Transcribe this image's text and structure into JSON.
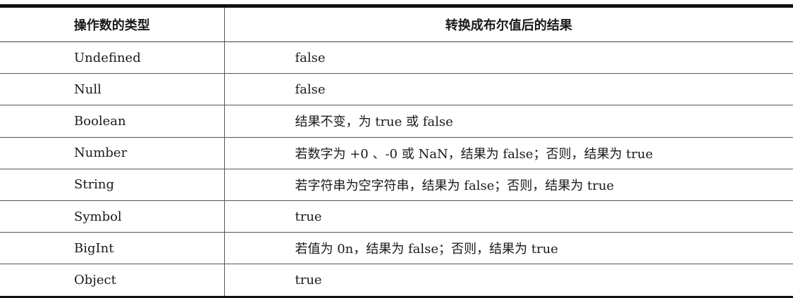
{
  "table": {
    "headers": [
      "操作数的类型",
      "转换成布尔值后的结果"
    ],
    "rows": [
      {
        "type": "Undefined",
        "result": "false"
      },
      {
        "type": "Null",
        "result": "false"
      },
      {
        "type": "Boolean",
        "result": "结果不变，为 true 或 false"
      },
      {
        "type": "Number",
        "result": "若数字为 +0 、-0 或 NaN，结果为 false；否则，结果为 true"
      },
      {
        "type": "String",
        "result": "若字符串为空字符串，结果为 false；否则，结果为 true"
      },
      {
        "type": "Symbol",
        "result": "true"
      },
      {
        "type": "BigInt",
        "result": "若值为 0n，结果为 false；否则，结果为 true"
      },
      {
        "type": "Object",
        "result": "true"
      }
    ]
  }
}
